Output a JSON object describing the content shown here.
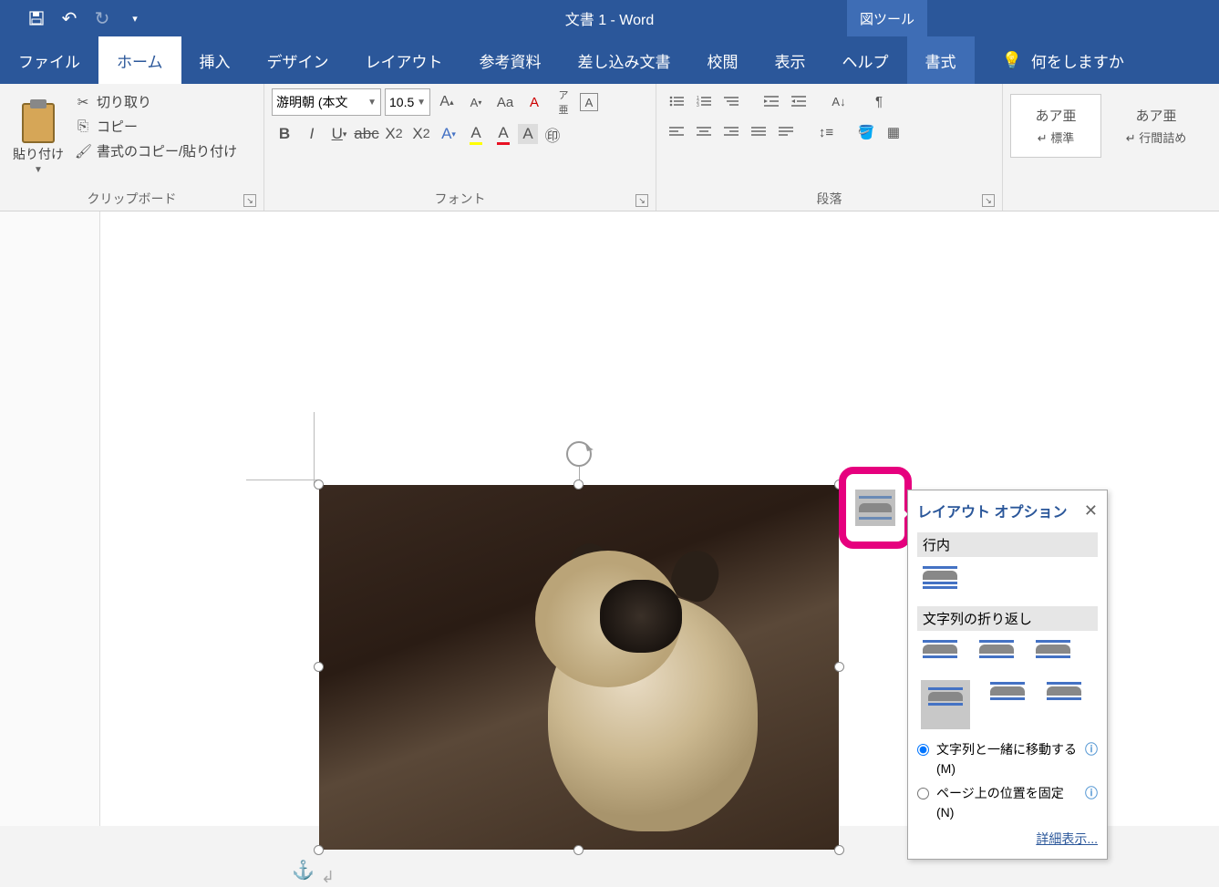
{
  "title": "文書 1  -  Word",
  "tool_tab": "図ツール",
  "qa": {
    "save": "💾",
    "undo": "↶",
    "redo": "↻",
    "more": "▾"
  },
  "tabs": {
    "file": "ファイル",
    "home": "ホーム",
    "insert": "挿入",
    "design": "デザイン",
    "layout": "レイアウト",
    "references": "参考資料",
    "mailings": "差し込み文書",
    "review": "校閲",
    "view": "表示",
    "help": "ヘルプ",
    "format": "書式"
  },
  "tell_me": "何をしますか",
  "ribbon": {
    "clipboard": {
      "paste": "貼り付け",
      "cut": "切り取り",
      "copy": "コピー",
      "format_painter": "書式のコピー/貼り付け",
      "group": "クリップボード"
    },
    "font": {
      "name": "游明朝 (本文",
      "size": "10.5",
      "group": "フォント"
    },
    "paragraph": {
      "group": "段落"
    },
    "styles": {
      "sample": "あア亜",
      "normal": "標準",
      "nospace": "行間詰め"
    }
  },
  "callout": {
    "title": "レイアウト オプション",
    "section_inline": "行内",
    "section_wrap": "文字列の折り返し",
    "radio_move": "文字列と一緒に移動する(M)",
    "radio_fix": "ページ上の位置を固定(N)",
    "detail": "詳細表示..."
  },
  "anchor_symbol": "⚓",
  "para_symbol": "↲"
}
